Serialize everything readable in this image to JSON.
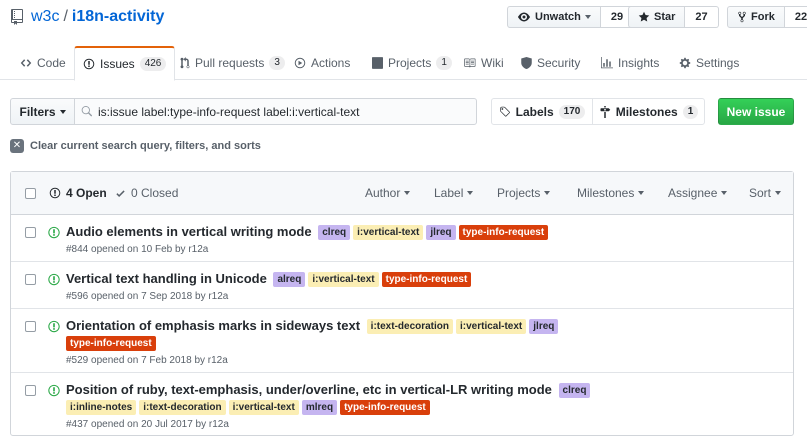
{
  "repo": {
    "owner": "w3c",
    "separator": "/",
    "name": "i18n-activity",
    "watch_label": "Unwatch",
    "watch_count": "29",
    "star_label": "Star",
    "star_count": "27",
    "fork_label": "Fork",
    "fork_count": "22"
  },
  "tabs": {
    "code": "Code",
    "issues": "Issues",
    "issues_count": "426",
    "pulls": "Pull requests",
    "pulls_count": "3",
    "actions": "Actions",
    "projects": "Projects",
    "projects_count": "1",
    "wiki": "Wiki",
    "security": "Security",
    "insights": "Insights",
    "settings": "Settings"
  },
  "toolbar": {
    "filters_label": "Filters",
    "search_value": "is:issue label:type-info-request label:i:vertical-text",
    "labels_label": "Labels",
    "labels_count": "170",
    "milestones_label": "Milestones",
    "milestones_count": "1",
    "new_issue_label": "New issue",
    "clear_query_label": "Clear current search query, filters, and sorts"
  },
  "list_header": {
    "open_label": "4 Open",
    "closed_label": "0 Closed",
    "author": "Author",
    "label": "Label",
    "projects": "Projects",
    "milestones": "Milestones",
    "assignee": "Assignee",
    "sort": "Sort"
  },
  "issues": [
    {
      "title": "Audio elements in vertical writing mode",
      "labels": [
        "clreq",
        "i:vertical-text",
        "jlreq",
        "type-info-request"
      ],
      "meta": "#844 opened on 10 Feb by r12a"
    },
    {
      "title": "Vertical text handling in Unicode",
      "labels": [
        "alreq",
        "i:vertical-text",
        "type-info-request"
      ],
      "meta": "#596 opened on 7 Sep 2018 by r12a"
    },
    {
      "title": "Orientation of emphasis marks in sideways text",
      "labels": [
        "i:text-decoration",
        "i:vertical-text",
        "jlreq",
        "type-info-request"
      ],
      "meta": "#529 opened on 7 Feb 2018 by r12a"
    },
    {
      "title": "Position of ruby, text-emphasis, under/overline, etc in vertical-LR writing mode",
      "labels": [
        "clreq",
        "i:inline-notes",
        "i:text-decoration",
        "i:vertical-text",
        "mlreq",
        "type-info-request"
      ],
      "meta": "#437 opened on 20 Jul 2017 by r12a"
    }
  ],
  "colors": {
    "link": "#0366d6",
    "open_issue": "#28a745",
    "label_script": "#c5b5f0",
    "label_topic": "#fbeeb4",
    "label_type": "#d93f0b",
    "tab_accent": "#e36209"
  },
  "icons": {
    "repo": "repo-icon",
    "eye": "eye-icon",
    "star": "star-icon",
    "fork": "fork-icon",
    "search": "search-icon",
    "tag": "tag-icon",
    "milestone": "milestone-icon",
    "issue_open": "issue-opened-icon",
    "check": "check-icon"
  }
}
